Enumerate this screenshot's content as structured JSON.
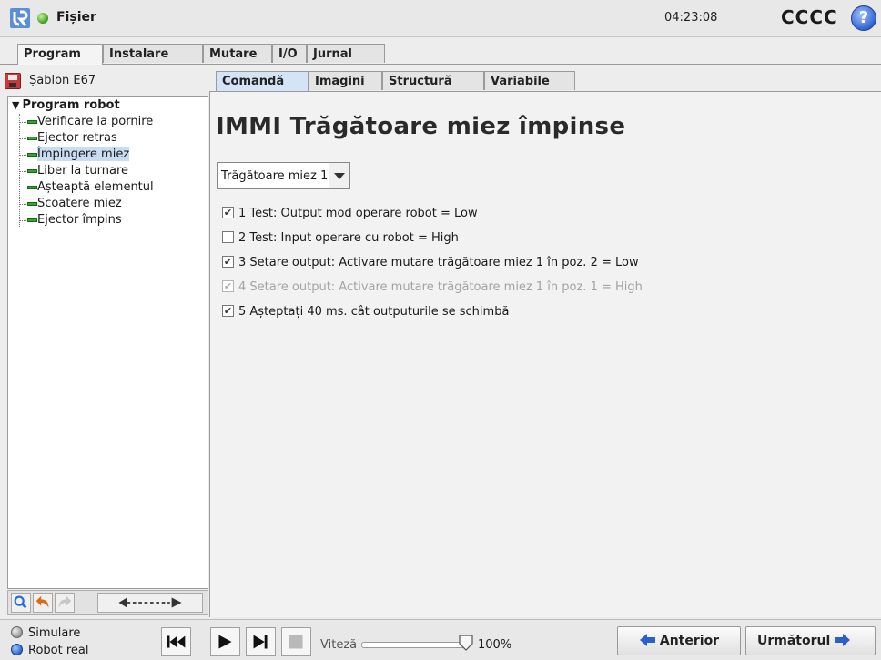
{
  "header": {
    "menu_label": "Fișier",
    "clock": "04:23:08",
    "robot_name": "CCCC",
    "help_label": "?"
  },
  "main_tabs": [
    "Program",
    "Instalare",
    "Mutare",
    "I/O",
    "Jurnal"
  ],
  "sub_tabs": [
    "Comandă",
    "Imagini",
    "Structură",
    "Variabile"
  ],
  "file": {
    "name": "Șablon E67"
  },
  "tree": {
    "root": "Program robot",
    "items": [
      "Verificare la pornire",
      "Ejector retras",
      "Împingere miez",
      "Liber la turnare",
      "Așteaptă elementul",
      "Scoatere miez",
      "Ejector împins"
    ],
    "selected_index": 2
  },
  "command": {
    "title": "IMMI Trăgătoare miez împinse",
    "selector_value": "Trăgătoare miez 1",
    "steps": [
      {
        "text": "1 Test: Output mod operare robot = Low",
        "checked": true,
        "enabled": true
      },
      {
        "text": "2 Test: Input operare cu robot = High",
        "checked": false,
        "enabled": true
      },
      {
        "text": "3 Setare output: Activare mutare trăgătoare miez 1 în poz. 2 = Low",
        "checked": true,
        "enabled": true
      },
      {
        "text": "4 Setare output: Activare mutare trăgătoare miez 1 în poz. 1 = High",
        "checked": true,
        "enabled": false
      },
      {
        "text": "5 Așteptați 40 ms. cât outputurile se schimbă",
        "checked": true,
        "enabled": true
      }
    ]
  },
  "footer": {
    "mode_simulation": "Simulare",
    "mode_real": "Robot real",
    "selected_mode": "Robot real",
    "speed_label": "Viteză",
    "speed_value": "100%",
    "speed_fraction": 1.0,
    "prev_label": "Anterior",
    "next_label": "Următorul"
  },
  "colors": {
    "selected_tree_bg": "#c8dcf2",
    "node_icon": "#2fa82f",
    "help_blue": "#2a5fd0"
  }
}
